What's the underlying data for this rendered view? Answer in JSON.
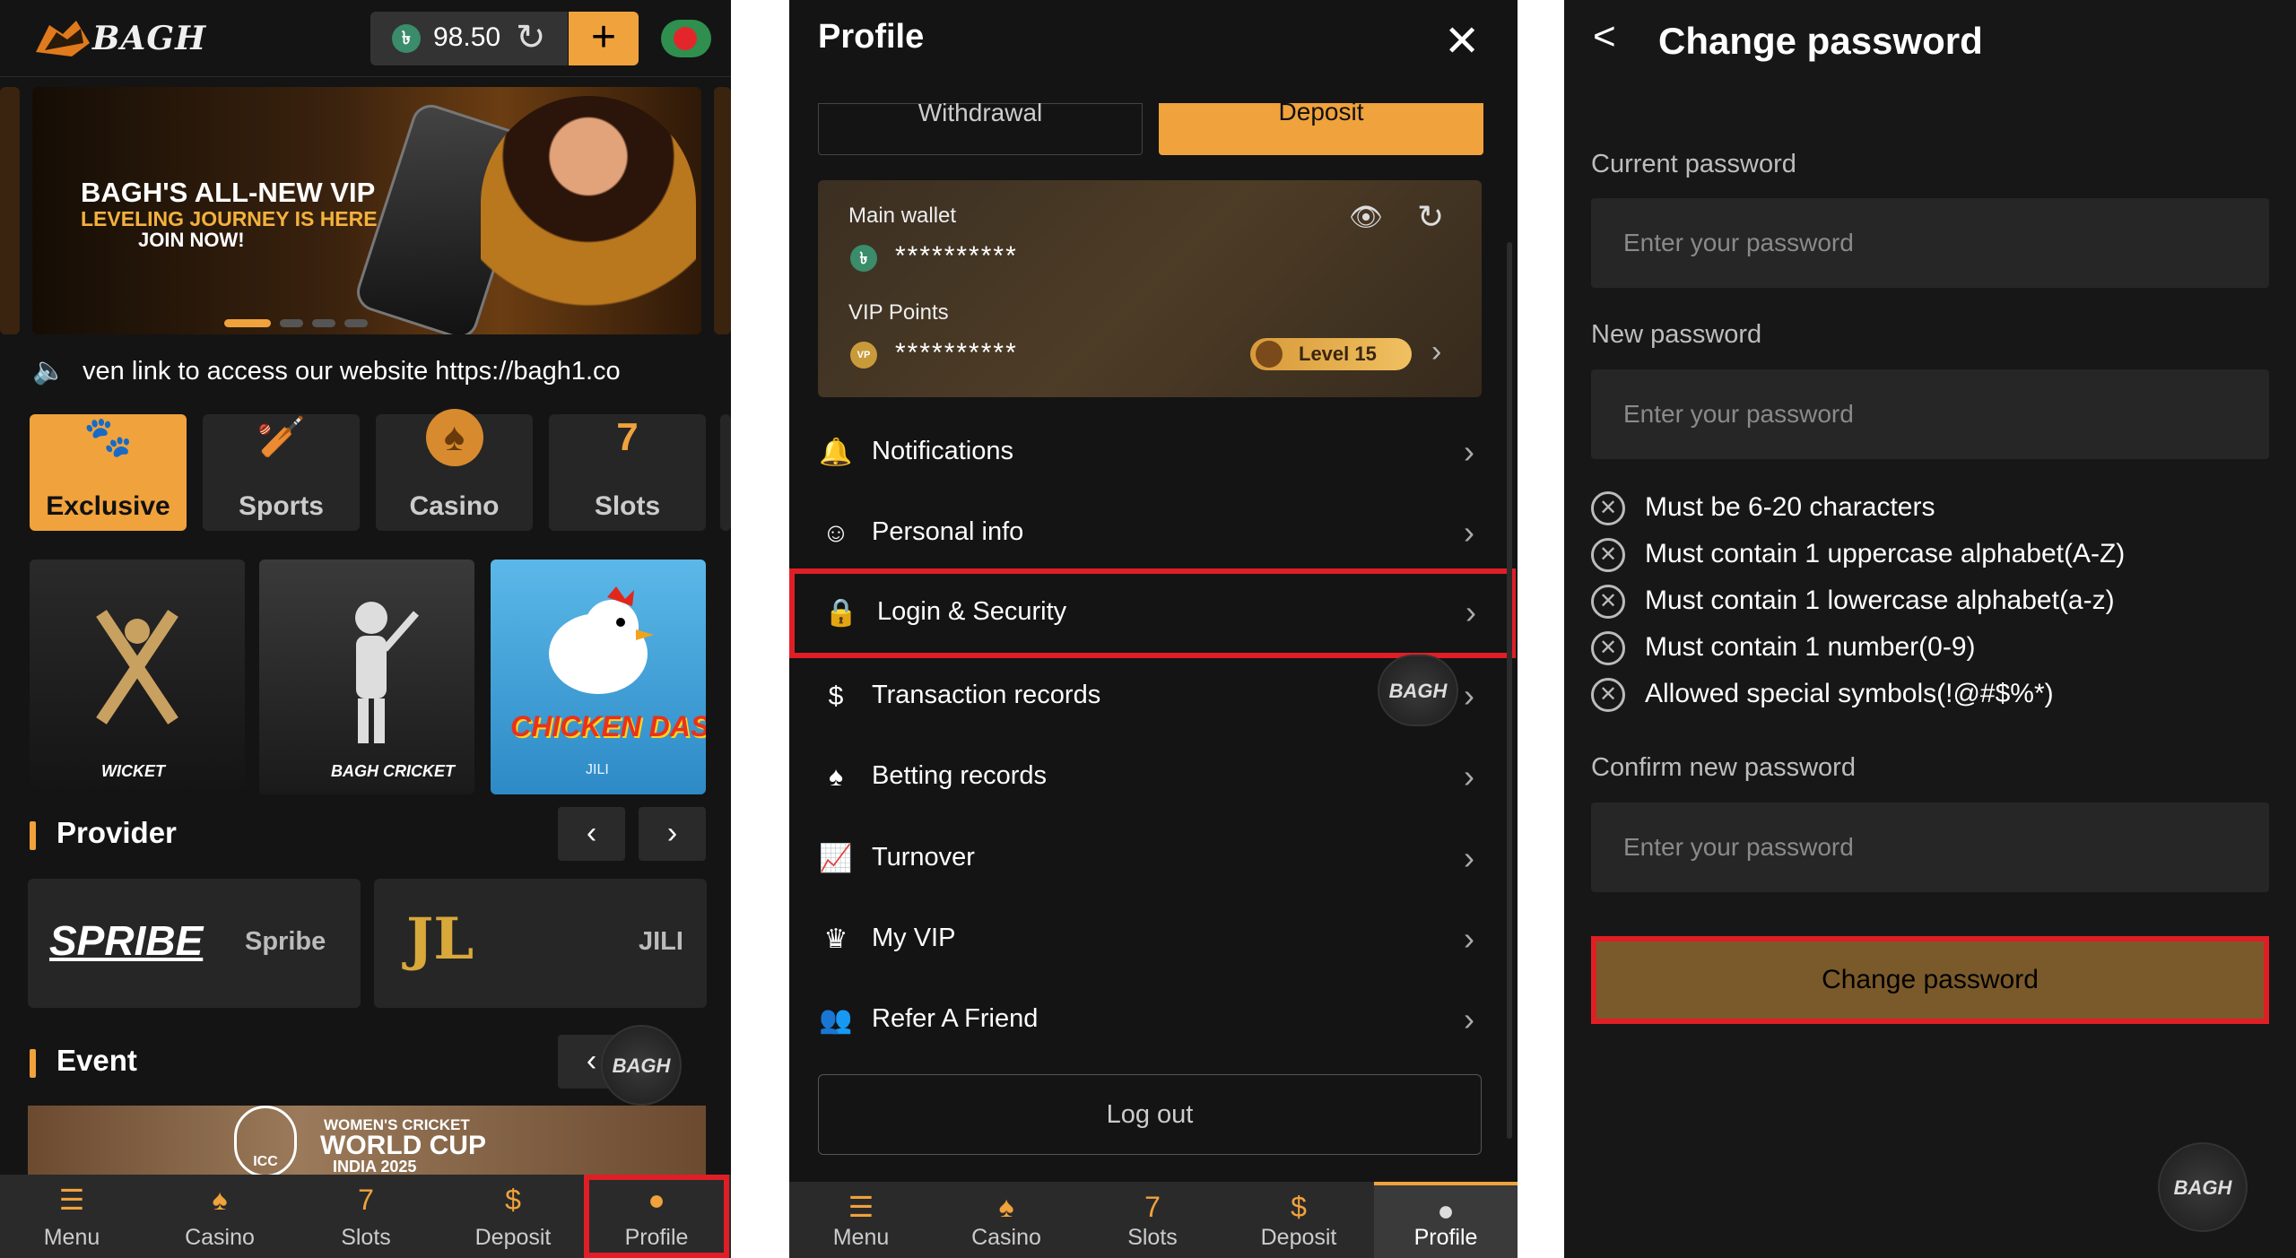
{
  "screen1": {
    "logo_text": "BAGH",
    "balance": "98.50",
    "balance_coin": "৳",
    "refresh_icon": "↻",
    "plus": "+",
    "banner": {
      "line1": "BAGH'S ALL-NEW VIP",
      "line2": "LEVELING JOURNEY IS HERE",
      "line3": "JOIN NOW!"
    },
    "marquee": "ven link to access our website https://bagh1.co",
    "categories": [
      {
        "label": "Exclusive",
        "icon": "🐾"
      },
      {
        "label": "Sports",
        "icon": "🏏"
      },
      {
        "label": "Casino",
        "icon": "♠"
      },
      {
        "label": "Slots",
        "icon": "7"
      }
    ],
    "games": [
      {
        "caption": "WICKET"
      },
      {
        "caption": "BAGH CRICKET"
      },
      {
        "title": "CHICKEN DASH!",
        "caption": "JILI"
      }
    ],
    "provider_title": "Provider",
    "providers": [
      {
        "logo": "SPRIBE",
        "name": "Spribe"
      },
      {
        "logo": "JL",
        "name": "JILI"
      }
    ],
    "event_title": "Event",
    "event_banner": {
      "line1": "WOMEN'S CRICKET",
      "line2": "WORLD CUP",
      "line3": "INDIA 2025",
      "badge": "ICC"
    },
    "fab": "BAGH",
    "nav": [
      {
        "label": "Menu",
        "icon": "☰"
      },
      {
        "label": "Casino",
        "icon": "♠"
      },
      {
        "label": "Slots",
        "icon": "7"
      },
      {
        "label": "Deposit",
        "icon": "$"
      },
      {
        "label": "Profile",
        "icon": "●"
      }
    ]
  },
  "screen2": {
    "title": "Profile",
    "withdrawal": "Withdrawal",
    "deposit": "Deposit",
    "main_wallet": "Main wallet",
    "main_wallet_value": "**********",
    "vip_points": "VIP Points",
    "vip_points_value": "**********",
    "vip_coin": "VP",
    "level": "Level 15",
    "menu": [
      {
        "label": "Notifications",
        "icon": "🔔"
      },
      {
        "label": "Personal info",
        "icon": "☺"
      },
      {
        "label": "Login & Security",
        "icon": "🔒"
      },
      {
        "label": "Transaction records",
        "icon": "$"
      },
      {
        "label": "Betting records",
        "icon": "♠"
      },
      {
        "label": "Turnover",
        "icon": "📈"
      },
      {
        "label": "My VIP",
        "icon": "♛"
      },
      {
        "label": "Refer A Friend",
        "icon": "👥"
      }
    ],
    "logout": "Log out",
    "nav": [
      {
        "label": "Menu",
        "icon": "☰"
      },
      {
        "label": "Casino",
        "icon": "♠"
      },
      {
        "label": "Slots",
        "icon": "7"
      },
      {
        "label": "Deposit",
        "icon": "$"
      },
      {
        "label": "Profile",
        "icon": "●"
      }
    ]
  },
  "screen3": {
    "back": "<",
    "title": "Change password",
    "current_label": "Current password",
    "current_placeholder": "Enter your password",
    "new_label": "New password",
    "new_placeholder": "Enter your password",
    "rules": [
      "Must be 6-20 characters",
      "Must contain 1 uppercase alphabet(A-Z)",
      "Must contain 1 lowercase alphabet(a-z)",
      "Must contain 1 number(0-9)",
      "Allowed special symbols(!@#$%*)"
    ],
    "confirm_label": "Confirm new password",
    "confirm_placeholder": "Enter your password",
    "submit": "Change password"
  },
  "colors": {
    "accent": "#f0a23c",
    "highlight": "#e01e26",
    "bg": "#141414"
  }
}
